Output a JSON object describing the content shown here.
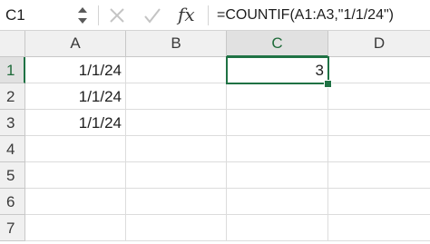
{
  "formula_bar": {
    "name_box_value": "C1",
    "fx_label": "fx",
    "formula": "=COUNTIF(A1:A3,\"1/1/24\")",
    "icons": {
      "stepper": "up-down-stepper-icon",
      "cancel": "close-icon",
      "confirm": "checkmark-icon",
      "function": "function-icon"
    }
  },
  "sheet": {
    "columns": [
      "A",
      "B",
      "C",
      "D"
    ],
    "rows": [
      "1",
      "2",
      "3",
      "4",
      "5",
      "6",
      "7"
    ],
    "active_cell": "C1",
    "active_column": "C",
    "active_row": "1",
    "cells": {
      "A1": "1/1/24",
      "A2": "1/1/24",
      "A3": "1/1/24",
      "C1": "3"
    }
  },
  "colors": {
    "accent": "#1f7244",
    "header_bg": "#f0f0f0",
    "grid_line": "#dcdcdc"
  }
}
